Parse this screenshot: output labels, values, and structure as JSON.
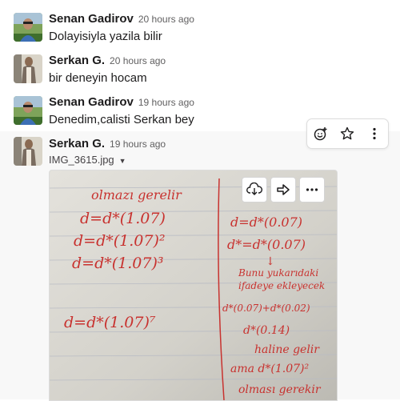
{
  "messages": [
    {
      "author": "Senan Gadirov",
      "time": "20 hours ago",
      "text": "Dolayisiyla yazila bilir"
    },
    {
      "author": "Serkan G.",
      "time": "20 hours ago",
      "text": "bir deneyin hocam"
    },
    {
      "author": "Senan Gadirov",
      "time": "19 hours ago",
      "text": "Denedim,calisti Serkan bey"
    },
    {
      "author": "Serkan G.",
      "time": "19 hours ago",
      "file_name": "IMG_3615.jpg"
    }
  ],
  "toolbar": {
    "icons": [
      "add-reaction-icon",
      "star-icon",
      "more-actions-icon"
    ]
  },
  "image_actions": {
    "icons": [
      "download-icon",
      "share-icon",
      "more-icon"
    ]
  },
  "handwriting": {
    "left": [
      "olmazı gerelir",
      "d=d*(1.07)",
      "d=d*(1.07)²",
      "d=d*(1.07)³",
      "d=d*(1.07)⁷"
    ],
    "right": [
      "d=d*(0.07)",
      "d*=d*(0.07)",
      "↓",
      "Bunu yukarıdaki",
      "ifadeye ekleyecek",
      "d*(0.07)+d*(0.02)",
      "d*(0.14)",
      "haline gelir",
      "ama d*(1.07)²",
      "olması gerekir"
    ]
  },
  "colors": {
    "ink": "#c8322f",
    "name": "#1d1c1d",
    "time": "#616061"
  }
}
